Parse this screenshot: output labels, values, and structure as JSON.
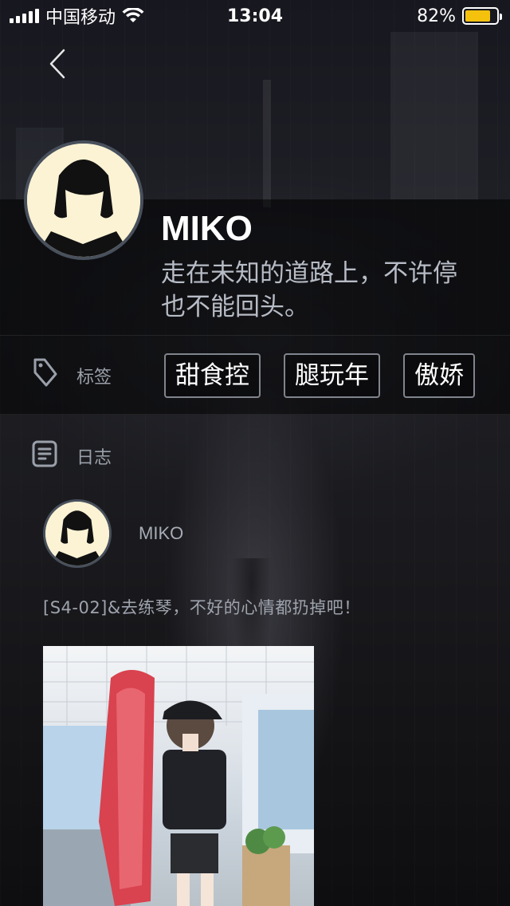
{
  "status_bar": {
    "carrier": "中国移动",
    "time": "13:04",
    "battery_percent": "82%",
    "battery_level": 0.82
  },
  "back": {
    "icon": "chevron-left-icon"
  },
  "profile": {
    "name": "MIKO",
    "bio_line1": "走在未知的道路上，不许停",
    "bio_line2": "也不能回头。"
  },
  "tags": {
    "label": "标签",
    "icon": "tag-icon",
    "items": [
      "甜食控",
      "腿玩年",
      "傲娇"
    ]
  },
  "diary": {
    "label": "日志",
    "icon": "document-icon",
    "post": {
      "author": "MIKO",
      "text": "[S4-02]&去练琴，不好的心情都扔掉吧！"
    }
  },
  "colors": {
    "battery": "#f4c20d",
    "avatar_bg": "#fbf3d4",
    "secondary_text": "#9aa0aa"
  }
}
